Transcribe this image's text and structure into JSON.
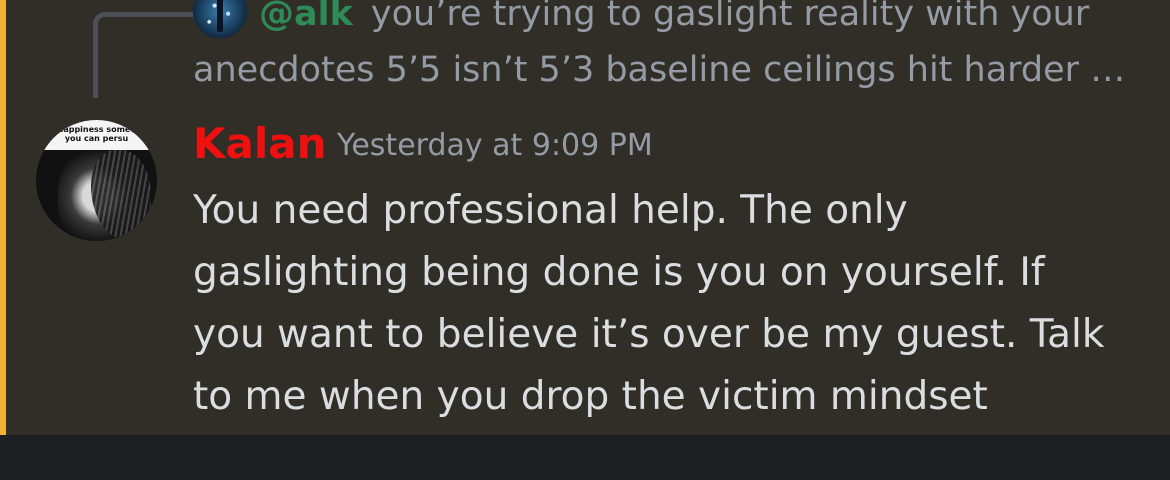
{
  "reply": {
    "mention": "@alk",
    "line1": "you’re trying to gaslight reality with your",
    "line2": "anecdotes 5’5 isn’t 5’3 baseline ceilings hit harder …"
  },
  "message": {
    "username": "Kalan",
    "timestamp": "Yesterday at 9:09 PM",
    "lines": [
      "You need professional help. The only",
      "gaslighting being done is you on yourself. If",
      "you want to believe it’s over be my guest. Talk",
      "to me when you drop the victim mindset"
    ],
    "avatar_text": "use happiness something you can persu"
  },
  "colors": {
    "highlight": "#f0b232",
    "username": "#f01010",
    "mention": "#2e8b57",
    "background": "#312d27"
  }
}
